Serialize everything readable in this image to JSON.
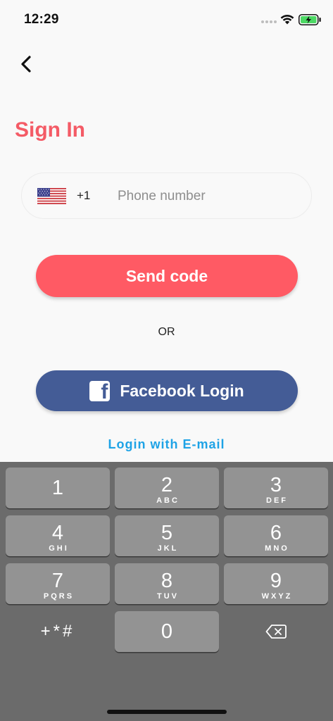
{
  "status_bar": {
    "time": "12:29"
  },
  "header": {
    "title": "Sign In"
  },
  "phone_field": {
    "country_code": "+1",
    "placeholder": "Phone number",
    "value": ""
  },
  "buttons": {
    "send_code": "Send code",
    "or": "OR",
    "facebook": "Facebook Login",
    "email": "Login with E-mail"
  },
  "keypad": {
    "keys": [
      {
        "digit": "1",
        "letters": ""
      },
      {
        "digit": "2",
        "letters": "ABC"
      },
      {
        "digit": "3",
        "letters": "DEF"
      },
      {
        "digit": "4",
        "letters": "GHI"
      },
      {
        "digit": "5",
        "letters": "JKL"
      },
      {
        "digit": "6",
        "letters": "MNO"
      },
      {
        "digit": "7",
        "letters": "PQRS"
      },
      {
        "digit": "8",
        "letters": "TUV"
      },
      {
        "digit": "9",
        "letters": "WXYZ"
      },
      {
        "digit": "0",
        "letters": ""
      }
    ],
    "symbols": "+*#"
  },
  "colors": {
    "accent": "#ff5a64",
    "title": "#f45b66",
    "facebook": "#445c96",
    "link": "#1ea3e6",
    "keyboard_bg": "#6b6b6b",
    "key_bg": "#939393"
  },
  "icons": [
    "back-chevron-icon",
    "us-flag-icon",
    "facebook-f-icon",
    "delete-backspace-icon",
    "wifi-icon",
    "battery-charging-icon"
  ]
}
